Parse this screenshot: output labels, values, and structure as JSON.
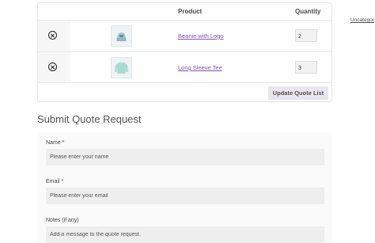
{
  "table": {
    "headers": {
      "product": "Product",
      "quantity": "Quantity"
    },
    "rows": [
      {
        "product": "Beanie with Logo",
        "quantity": "2"
      },
      {
        "product": "Long Sleeve Tee",
        "quantity": "3"
      }
    ],
    "update_label": "Update Quote List"
  },
  "sidebar": {
    "category_link": "Uncategor"
  },
  "form": {
    "title": "Submit Quote Request",
    "name": {
      "label": "Name *",
      "placeholder": "Please enter your name"
    },
    "email": {
      "label": "Email *",
      "placeholder": "Please enter your email"
    },
    "notes": {
      "label": "Notes (if any)",
      "placeholder": "Add a message to the quote request."
    }
  },
  "colors": {
    "link": "#7f54b3",
    "button_bg": "#e9e6ed",
    "input_bg": "#eeeeee"
  }
}
